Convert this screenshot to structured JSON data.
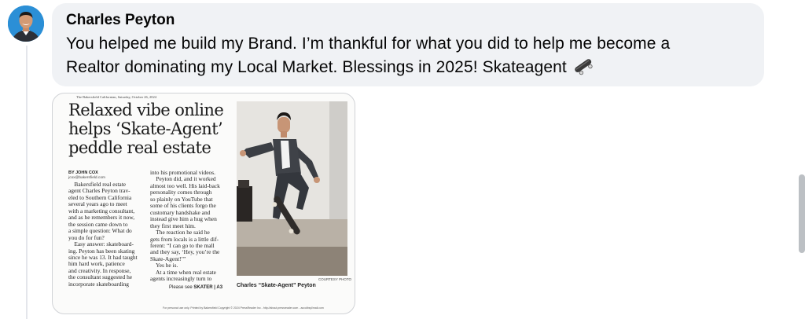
{
  "comment": {
    "author": "Charles Peyton",
    "line1": "You helped me build my Brand. I’m thankful for what you did to help me become a",
    "line2": "Realtor dominating my Local Market. Blessings in 2025! Skateagent",
    "trailing_icon": "skateboard-icon",
    "avatar_icon": "profile-photo"
  },
  "attachment": {
    "header": "The Bakersfield Californian, Saturday, October 26, 2024",
    "headline": "Relaxed vibe online helps ‘Skate-Agent’ peddle real estate",
    "byline": "BY JOHN COX",
    "email": "jcox@bakersfield.com",
    "column1": "    Bakersfield real estate\nagent Charles Peyton trav-\neled to Southern California\nseveral years ago to meet\nwith a marketing consultant,\nand as he remembers it now,\nthe session came down to\na simple question: What do\nyou do for fun?\n    Easy answer: skateboard-\ning. Peyton has been skating\nsince he was 13. It had taught\nhim hard work, patience\nand creativity. In response,\nthe consultant suggested he\nincorporate skateboarding",
    "column2": "into his promotional videos.\n    Peyton did, and it worked\nalmost too well. His laid-back\npersonality comes through\nso plainly on YouTube that\nsome of his clients forgo the\ncustomary handshake and\ninstead give him a hug when\nthey first meet him.\n    The reaction he said he\ngets from locals is a little dif-\nferent: “I can go to the mall\nand they say, ‘Hey, you’re the\nSkate-Agent!’”\n    Yes he is.\n    At a time when real estate\nagents increasingly turn to",
    "jump_prefix": "Please see",
    "jump_ref": "SKATER | A3",
    "photo_credit": "COURTESY PHOTO",
    "caption": "Charles “Skate-Agent” Peyton",
    "footer": "For personal use only. Printed by Bakersfield Copyright © 2024 PressReader Inc - http://about.pressreader.com - accolbsyl/mail.com"
  },
  "colors": {
    "bubble": "#f0f2f5",
    "text": "#050505",
    "avatar_bg": "#2b8fd6",
    "thread_line": "#e4e6eb"
  }
}
